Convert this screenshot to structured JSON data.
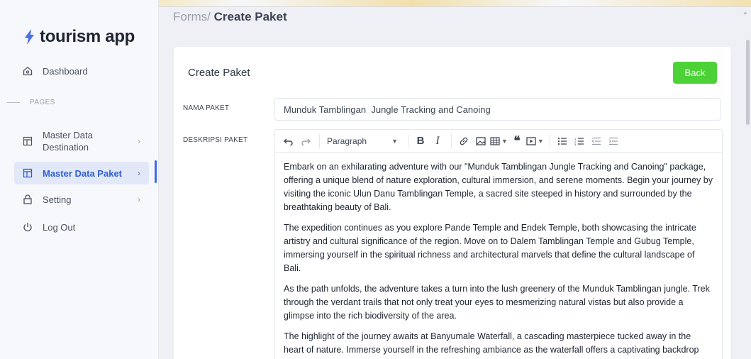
{
  "app": {
    "name": "tourism app"
  },
  "breadcrumb": {
    "parent": "Forms/",
    "current": "Create Paket"
  },
  "sidebar": {
    "dashboard": "Dashboard",
    "section": "PAGES",
    "items": [
      {
        "label": "Master Data Destination"
      },
      {
        "label": "Master Data Paket"
      },
      {
        "label": "Setting"
      }
    ],
    "logout": "Log Out"
  },
  "card": {
    "title": "Create Paket",
    "back_label": "Back",
    "nama_label": "NAMA PAKET",
    "nama_value": "Munduk Tamblingan  Jungle Tracking and Canoing",
    "desk_label": "DESKRIPSI PAKET"
  },
  "editor": {
    "paragraph_style": "Paragraph",
    "paragraphs": [
      "Embark on an exhilarating adventure with our \"Munduk Tamblingan Jungle Tracking and Canoing\" package, offering a unique blend of nature exploration, cultural immersion, and serene moments. Begin your journey by visiting the iconic Ulun Danu Tamblingan Temple, a sacred site steeped in history and surrounded by the breathtaking beauty of Bali.",
      "The expedition continues as you explore Pande Temple and Endek Temple, both showcasing the intricate artistry and cultural significance of the region. Move on to Dalem Tamblingan Temple and Gubug Temple, immersing yourself in the spiritual richness and architectural marvels that define the cultural landscape of Bali.",
      "As the path unfolds, the adventure takes a turn into the lush greenery of the Munduk Tamblingan jungle. Trek through the verdant trails that not only treat your eyes to mesmerizing natural vistas but also provide a glimpse into the rich biodiversity of the area.",
      "The highlight of the journey awaits at Banyumale Waterfall, a cascading masterpiece tucked away in the heart of nature. Immerse yourself in the refreshing ambiance as the waterfall offers a captivating backdrop"
    ]
  },
  "colors": {
    "accent": "#3d6be3",
    "back_button": "#4cd137"
  },
  "icons": {
    "logo": "bolt-logo-icon",
    "dashboard": "home-icon",
    "master_data": "table-icon",
    "setting": "lock-icon",
    "logout": "power-icon"
  }
}
